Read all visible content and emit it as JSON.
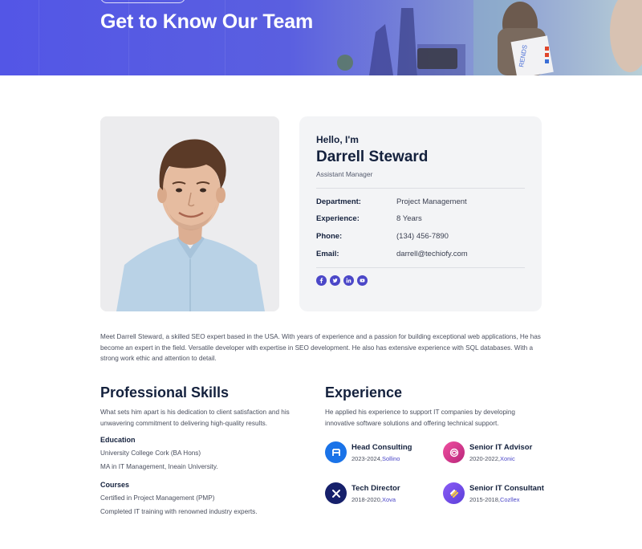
{
  "hero": {
    "title": "Get to Know Our Team",
    "photo_sign_text": "RENDS"
  },
  "profile": {
    "greeting": "Hello, I'm",
    "name": "Darrell Steward",
    "role": "Assistant Manager",
    "details": [
      {
        "label": "Department:",
        "value": "Project Management"
      },
      {
        "label": "Experience:",
        "value": "8 Years"
      },
      {
        "label": "Phone:",
        "value": "(134) 456-7890"
      },
      {
        "label": "Email:",
        "value": "darrell@techiofy.com"
      }
    ],
    "socials": [
      "facebook-icon",
      "twitter-icon",
      "linkedin-icon",
      "youtube-icon"
    ],
    "accent": "#4b47c8"
  },
  "bio": "Meet Darrell Steward, a skilled SEO expert based in the USA. With years of experience and a passion for building exceptional web applications, He has become an expert in the field. Versatile developer with expertise in SEO development. He also has extensive experience with SQL databases. With a strong work ethic and attention to detail.",
  "skills": {
    "heading": "Professional Skills",
    "intro": "What sets him apart is his dedication to client satisfaction and his unwavering commitment to delivering high-quality results.",
    "education_heading": "Education",
    "education": [
      "University College Cork (BA Hons)",
      "MA in IT Management, Ineain University."
    ],
    "courses_heading": "Courses",
    "courses": [
      "Certified in Project Management (PMP)",
      "Completed IT training with renowned industry experts."
    ]
  },
  "experience": {
    "heading": "Experience",
    "intro": "He applied his experience to support IT companies by developing innovative software solutions and offering technical support.",
    "items": [
      {
        "title": "Head Consulting",
        "years": "2023-2024,",
        "company": "Sollino",
        "icon": "sollino-logo-icon",
        "color": "#1a73e8"
      },
      {
        "title": "Senior IT Advisor",
        "years": "2020-2022,",
        "company": "Xonic",
        "icon": "xonic-logo-icon",
        "color": "#d6338f"
      },
      {
        "title": "Tech Director",
        "years": "2018-2020,",
        "company": "Xova",
        "icon": "xova-logo-icon",
        "color": "#16206b"
      },
      {
        "title": "Senior IT Consultant",
        "years": "2015-2018,",
        "company": "Cozllex",
        "icon": "cozllex-logo-icon",
        "color": "#7b4df0"
      }
    ]
  }
}
